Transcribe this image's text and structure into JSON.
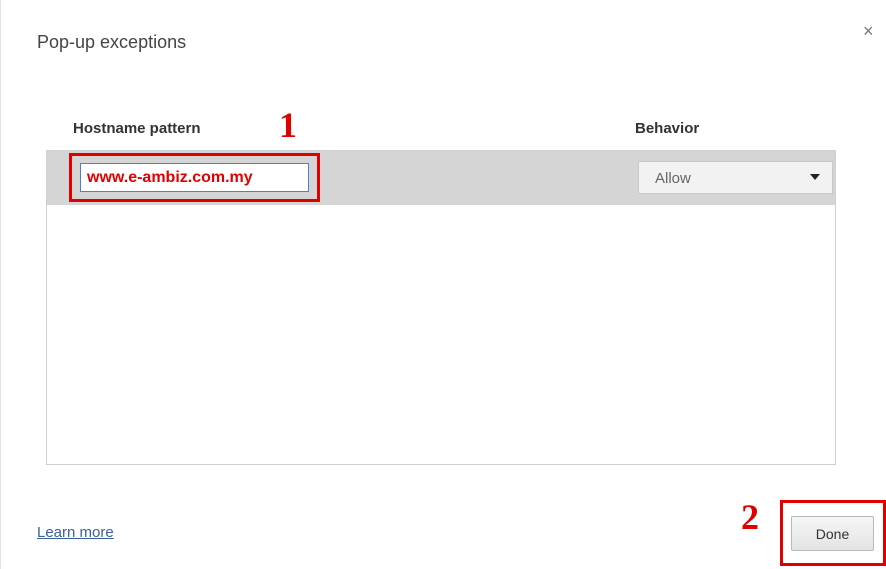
{
  "dialog": {
    "title": "Pop-up exceptions",
    "close_icon": "close-icon"
  },
  "table": {
    "columns": [
      "Hostname pattern",
      "Behavior"
    ],
    "rows": [
      {
        "hostname": "www.e-ambiz.com.my",
        "behavior": "Allow"
      }
    ]
  },
  "annotations": {
    "step1": "1",
    "step2": "2",
    "color": "#e00000"
  },
  "footer": {
    "learn_more": "Learn more",
    "done_label": "Done"
  }
}
